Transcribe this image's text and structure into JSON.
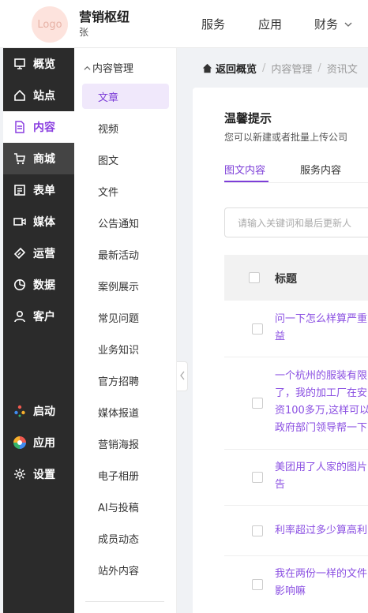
{
  "header": {
    "logo_text": "Logo",
    "brand": "营销枢纽",
    "user": "张",
    "nav": [
      "服务",
      "应用",
      "财务"
    ]
  },
  "sidenav": {
    "items": [
      {
        "label": "概览",
        "icon": "dashboard-icon"
      },
      {
        "label": "站点",
        "icon": "home-icon"
      },
      {
        "label": "内容",
        "icon": "document-icon",
        "active": true
      },
      {
        "label": "商城",
        "icon": "cart-icon"
      },
      {
        "label": "表单",
        "icon": "form-icon"
      },
      {
        "label": "媒体",
        "icon": "video-icon"
      },
      {
        "label": "运营",
        "icon": "tag-icon"
      },
      {
        "label": "数据",
        "icon": "pie-chart-icon"
      },
      {
        "label": "客户",
        "icon": "user-icon"
      }
    ],
    "bottom_items": [
      {
        "label": "启动",
        "icon": "launch-dots-icon"
      },
      {
        "label": "应用",
        "icon": "apps-color-icon"
      },
      {
        "label": "设置",
        "icon": "gear-icon"
      }
    ]
  },
  "submenu": {
    "header": "内容管理",
    "items": [
      "文章",
      "视频",
      "图文",
      "文件",
      "公告通知",
      "最新活动",
      "案例展示",
      "常见问题",
      "业务知识",
      "官方招聘",
      "媒体报道",
      "营销海报",
      "电子相册",
      "AI与投稿",
      "成员动态",
      "站外内容"
    ]
  },
  "breadcrumb": {
    "home": "返回概览",
    "level1": "内容管理",
    "level2": "资讯文"
  },
  "tip": {
    "title": "温馨提示",
    "desc": "您可以新建或者批量上传公司"
  },
  "tabs": [
    "图文内容",
    "服务内容"
  ],
  "search": {
    "placeholder": "请输入关键词和最后更新人"
  },
  "table": {
    "header_title": "标题",
    "rows": [
      {
        "lines": [
          "问一下怎么样算严重",
          "益"
        ]
      },
      {
        "lines": [
          "一个杭州的服装有限",
          "了，我的加工厂在安",
          "资100多万,这样可以",
          "政府部门领导帮一下"
        ]
      },
      {
        "lines": [
          "美团用了人家的图片",
          "告"
        ]
      },
      {
        "lines": [
          "利率超过多少算高利"
        ]
      },
      {
        "lines": [
          "我在两份一样的文件",
          "影响嘛"
        ]
      }
    ]
  },
  "colors": {
    "accent": "#7d3ed8",
    "sidebar_bg": "#2b2b2b",
    "link": "#8a4fe2"
  }
}
